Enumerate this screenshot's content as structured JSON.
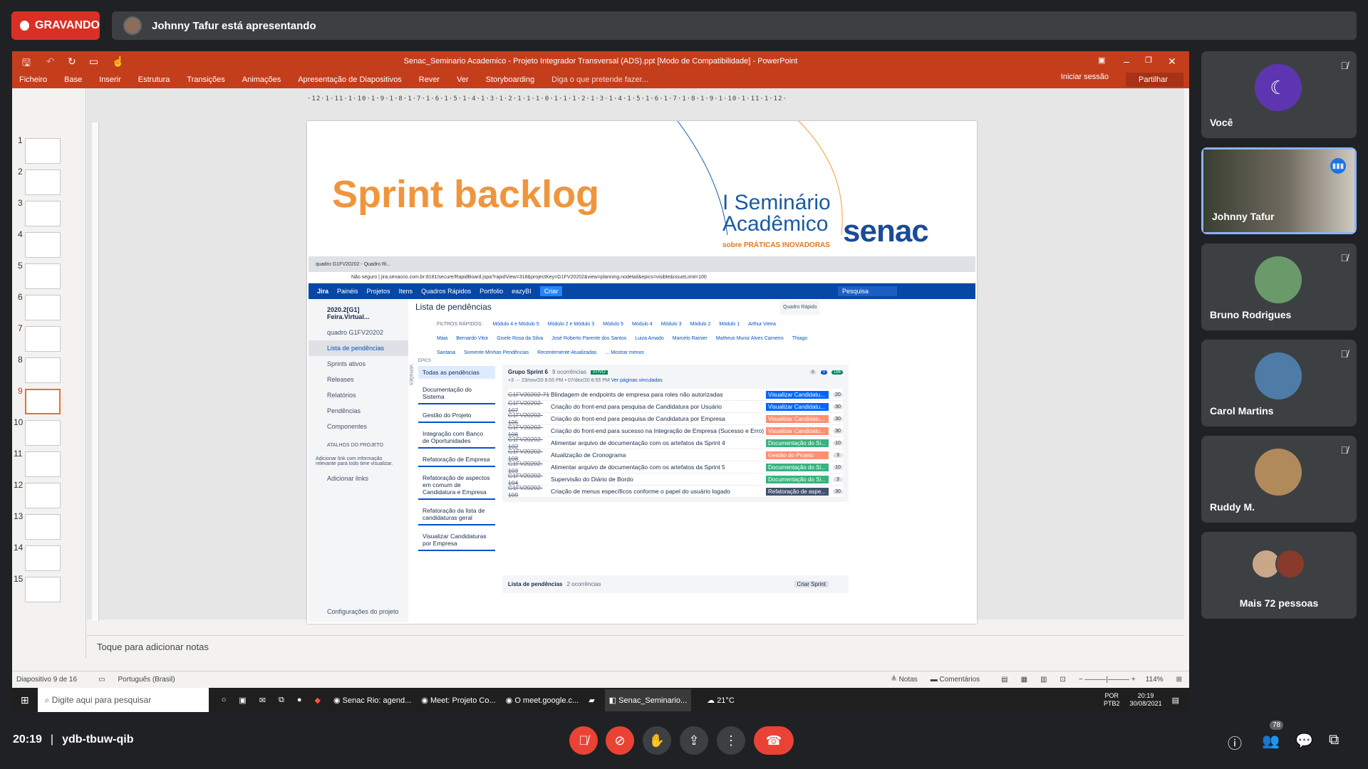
{
  "meet": {
    "recording_label": "GRAVANDO",
    "presenting_text": "Johnny Tafur está apresentando",
    "time": "20:19",
    "separator": "|",
    "meeting_code": "ydb-tbuw-qib",
    "people_badge": "78"
  },
  "participants": [
    {
      "name": "Você",
      "muted": true
    },
    {
      "name": "Johnny Tafur",
      "muted": false,
      "speaking": true
    },
    {
      "name": "Bruno Rodrigues",
      "muted": true
    },
    {
      "name": "Carol Martins",
      "muted": true
    },
    {
      "name": "Ruddy M.",
      "muted": true
    },
    {
      "name": "Mais 72 pessoas"
    }
  ],
  "ppt": {
    "window_title": "Senac_Seminario Academico - Projeto Integrador Transversal (ADS).ppt [Modo de Compatibilidade] - PowerPoint",
    "tabs": [
      "Ficheiro",
      "Base",
      "Inserir",
      "Estrutura",
      "Transições",
      "Animações",
      "Apresentação de Diapositivos",
      "Rever",
      "Ver",
      "Storyboarding",
      "Diga o que pretende fazer..."
    ],
    "sign_in": "Iniciar sessão",
    "share": "Partilhar",
    "ruler_text": "·12·1·11·1·10·1·9·1·8·1·7·1·6·1·5·1·4·1·3·1·2·1·1·1·0·1·1·1·2·1·3·1·4·1·5·1·6·1·7·1·8·1·9·1·10·1·11·1·12·",
    "notes_placeholder": "Toque para adicionar notas",
    "status_slide": "Diapositivo 9 de 16",
    "status_language": "Português (Brasil)",
    "status_notes": "Notas",
    "status_comments": "Comentários",
    "zoom": "114%",
    "slide_numbers": [
      "1",
      "2",
      "3",
      "4",
      "5",
      "6",
      "7",
      "8",
      "9",
      "10",
      "11",
      "12",
      "13",
      "14",
      "15"
    ],
    "selected_slide": "9"
  },
  "slide": {
    "title": "Sprint backlog",
    "logo_line1": "I Seminário",
    "logo_line2": "Acadêmico",
    "logo_tagline": "sobre PRÁTICAS INOVADORAS",
    "brand": "senac"
  },
  "jira": {
    "tab_title": "quadro G1FV20202 - Quadro Ri...",
    "address": "Não seguro | jira.senacrio.com.br:8181/secure/RapidBoard.jspa?rapidView=318&projectKey=G1FV20202&view=planning.nodetail&epics=visible&issueLimit=100",
    "nav": [
      "Jira",
      "Painéis",
      "Projetos",
      "Itens",
      "Quadros Rápidos",
      "Portfolio",
      "eazyBI",
      "Criar"
    ],
    "search_placeholder": "Pesquisa",
    "project_name": "2020.2[G1] Feira.Virtual...",
    "board_name": "quadro G1FV20202",
    "side_items": [
      "Lista de pendências",
      "Sprints ativos",
      "Releases",
      "Relatórios",
      "Pendências",
      "Componentes"
    ],
    "shortcuts_heading": "ATALHOS DO PROJETO",
    "shortcuts_text": "Adicionar link com informação relevante para todo time visualizar.",
    "add_links": "Adicionar links",
    "project_settings": "Configurações do projeto",
    "page_title": "Lista de pendências",
    "quick_board": "Quadro Rápido",
    "filters_label": "FILTROS RÁPIDOS:",
    "filters": [
      "Módulo 4 e Módulo 5",
      "Módulo 2 e Módulo 3",
      "Módulo 5",
      "Módulo 4",
      "Módulo 3",
      "Módulo 2",
      "Módulo 1",
      "Arthur Vieira Maia",
      "Bernardo Vitor",
      "Gisele Rosa da Silva",
      "José Roberto Parente dos Santos",
      "Luiza Amado",
      "Marcelo Rainier",
      "Matheus Muniz Alves Carneiro",
      "Thiago Santana",
      "Somente Minhas Pendências",
      "Recentemente Atualizadas",
      "... Mostrar menos"
    ],
    "epics_label": "EPICS",
    "versions_label": "VERSÕES",
    "epics": [
      "Todas as pendências",
      "Documentação do Sistema",
      "Gestão do Projeto",
      "Integração com Banco de Oportunidades",
      "Refatoração de Empresa",
      "Refatoração de aspectos em comum de Candidatura e Empresa",
      "Refatoração da lista de candidaturas geral",
      "Visualizar Candidaturas por Empresa"
    ],
    "sprint_name": "Grupo Sprint 6",
    "sprint_count": "9 ocorrências",
    "sprint_status": "ATIVO",
    "sprint_dates": "23/nov/20 8:55 PM  •  07/dez/20 8:55 PM",
    "sprint_linked": "Ver páginas vinculadas",
    "sprint_badges": [
      "0",
      "0",
      "166"
    ],
    "sprint_plus": "+3",
    "issues": [
      {
        "key": "G1FV20202-71",
        "summary": "Blindagem de endpoints de empresa para roles não autorizadas",
        "label": "Visualizar Candidatu...",
        "color": "#0065ff",
        "points": "20"
      },
      {
        "key": "G1FV20202-107",
        "summary": "Criação do front-end para pesquisa de Candidatura por Usuário",
        "label": "Visualizar Candidatu...",
        "color": "#0065ff",
        "points": "30"
      },
      {
        "key": "G1FV20202-105",
        "summary": "Criação do front-end para pesquisa de Candidatura por Empresa",
        "label": "Visualizar Candidatu...",
        "color": "#ff8f73",
        "points": "30"
      },
      {
        "key": "G1FV20202-106",
        "summary": "Criação do front-end para sucesso na Integração de Empresa (Sucesso e Erro)",
        "label": "Visualizar Candidatu...",
        "color": "#ff8f73",
        "points": "30"
      },
      {
        "key": "G1FV20202-102",
        "summary": "Alimentar arquivo de documentação com os artefatos da Sprint 4",
        "label": "Documentação do Si...",
        "color": "#36b37e",
        "points": "10"
      },
      {
        "key": "G1FV20202-108",
        "summary": "Atualização de Cronograma",
        "label": "Gestão do Projeto",
        "color": "#ff8f73",
        "points": "3"
      },
      {
        "key": "G1FV20202-103",
        "summary": "Alimentar arquivo de documentação com os artefatos da Sprint 5",
        "label": "Documentação do Si...",
        "color": "#36b37e",
        "points": "10"
      },
      {
        "key": "G1FV20202-104",
        "summary": "Supervisão do Diário de Bordo",
        "label": "Documentação do Si...",
        "color": "#36b37e",
        "points": "3"
      },
      {
        "key": "G1FV20202-109",
        "summary": "Criação de menus específicos conforme o papel do usuário logado",
        "label": "Refatoração de aspe...",
        "color": "#42526e",
        "points": "30"
      }
    ],
    "backlog_title": "Lista de pendências",
    "backlog_count": "2 ocorrências",
    "create_sprint": "Criar Sprint"
  },
  "taskbar": {
    "search_placeholder": "Digite aqui para pesquisar",
    "items": [
      "Senac Rio: agend...",
      "Meet: Projeto Co...",
      "O meet.google.c...",
      "Senac_Seminario..."
    ],
    "weather": "21°C",
    "lang1": "POR",
    "lang2": "PTB2",
    "clock_time": "20:19",
    "clock_date": "30/08/2021"
  }
}
